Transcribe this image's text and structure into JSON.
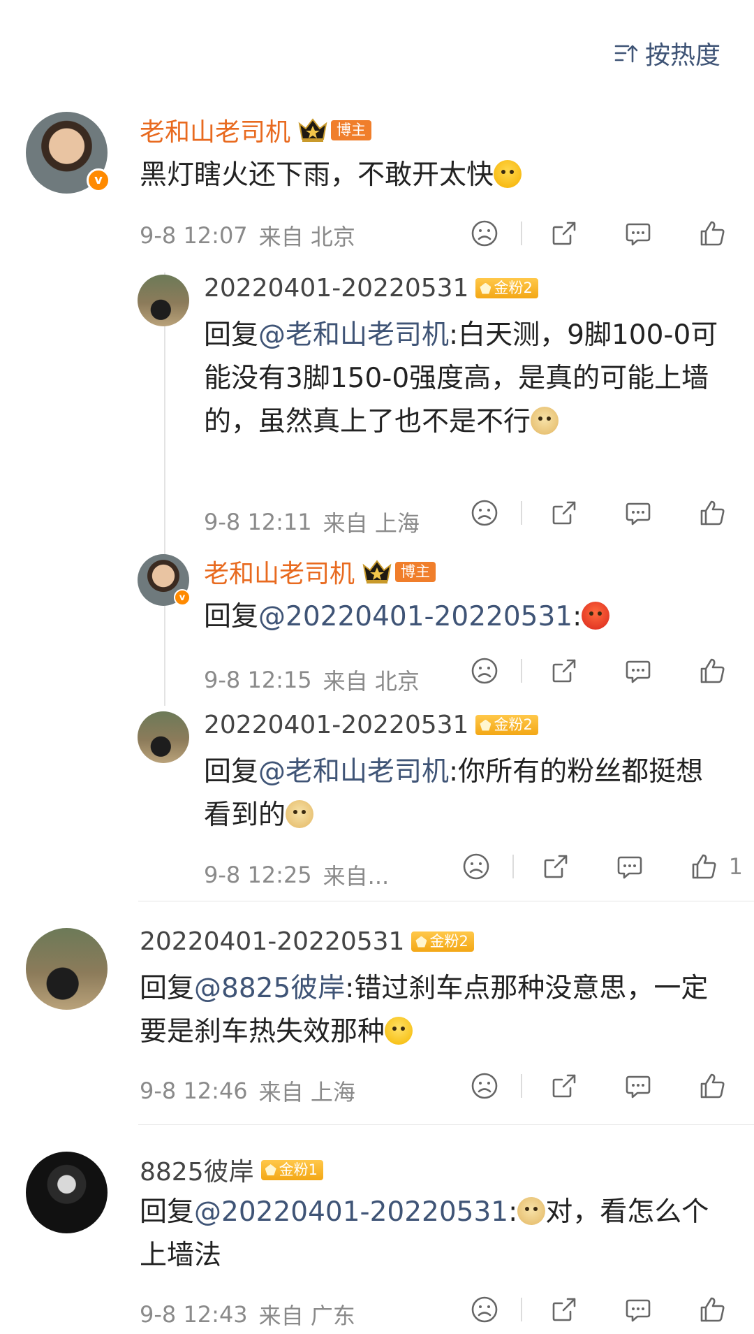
{
  "sort": {
    "label": "按热度",
    "icon": "sort-icon"
  },
  "colors": {
    "owner_name": "#e86a1f",
    "mention": "#3f5476",
    "meta": "#8a8a8a",
    "fan_badge": "#f3a715",
    "blogger_badge": "#f07e2b"
  },
  "comments": [
    {
      "user": "老和山老司机",
      "badge": "博主",
      "text": "黑灯瞎火还下雨，不敢开太快",
      "time": "9-8 12:07",
      "from": "来自 北京"
    },
    {
      "user": "20220401-20220531",
      "badge": "金粉2",
      "reply_prefix": "回复",
      "mention": "@老和山老司机",
      "colon": ":",
      "text": "白天测，9脚100-0可能没有3脚150-0强度高，是真的可能上墙的，虽然真上了也不是不行",
      "time": "9-8 12:11",
      "from": "来自 上海"
    },
    {
      "user": "老和山老司机",
      "badge": "博主",
      "reply_prefix": "回复",
      "mention": "@20220401-20220531",
      "colon": ":",
      "time": "9-8 12:15",
      "from": "来自 北京"
    },
    {
      "user": "20220401-20220531",
      "badge": "金粉2",
      "reply_prefix": "回复",
      "mention": "@老和山老司机",
      "colon": ":",
      "text": "你所有的粉丝都挺想看到的",
      "time": "9-8 12:25",
      "from": "来自...",
      "likes": "1"
    },
    {
      "user": "20220401-20220531",
      "badge": "金粉2",
      "reply_prefix": "回复",
      "mention": "@8825彼岸",
      "colon": ":",
      "text": "错过刹车点那种没意思，一定要是刹车热失效那种",
      "time": "9-8 12:46",
      "from": "来自 上海"
    },
    {
      "user": "8825彼岸",
      "badge": "金粉1",
      "reply_prefix": "回复",
      "mention": "@20220401-20220531",
      "colon": ":",
      "text": "对，看怎么个上墙法",
      "time": "9-8 12:43",
      "from": "来自 广东"
    }
  ]
}
